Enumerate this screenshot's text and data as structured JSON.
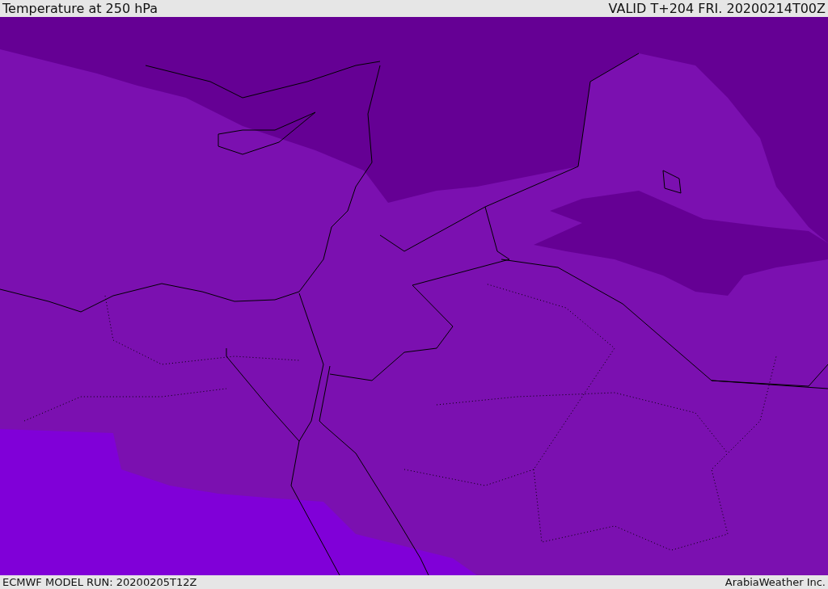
{
  "header": {
    "title": "Temperature at 250 hPa",
    "valid": "VALID T+204 FRI. 20200214T00Z"
  },
  "footer": {
    "model_run": "ECMWF MODEL RUN: 20200205T12Z",
    "credit": "ArabiaWeather Inc."
  }
}
